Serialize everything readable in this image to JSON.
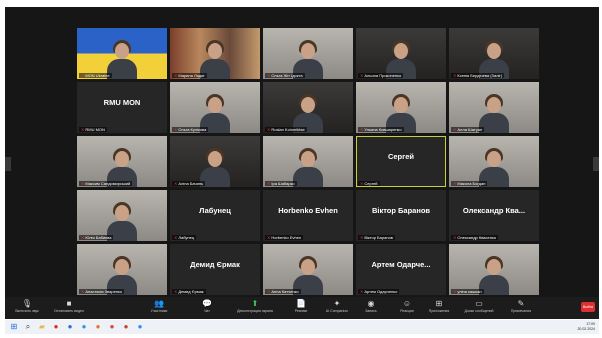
{
  "participants": [
    {
      "name": "",
      "label": "MON Ukraine",
      "bg": "flag"
    },
    {
      "name": "",
      "label": "Марина Лядиг",
      "bg": "books"
    },
    {
      "name": "",
      "label": "Ольга Жіт Ідокта",
      "bg": "room-light"
    },
    {
      "name": "",
      "label": "Альона Прокопенко",
      "bg": "room-dark"
    },
    {
      "name": "",
      "label": "Ксенія Бердічева (Заліг)",
      "bg": "room-dark"
    },
    {
      "name": "RMU MON",
      "label": "RMU MON",
      "bg": "plain"
    },
    {
      "name": "",
      "label": "Ольга Кулікова",
      "bg": "room-light"
    },
    {
      "name": "",
      "label": "Ruslan Kolomibtse",
      "bg": "room-dark"
    },
    {
      "name": "",
      "label": "Ульяна Ковшаренко",
      "bg": "room-light"
    },
    {
      "name": "",
      "label": "Алла Шатуан",
      "bg": "room-light"
    },
    {
      "name": "",
      "label": "Максим Сандомирський",
      "bg": "room-light"
    },
    {
      "name": "",
      "label": "Аліна Бачинь",
      "bg": "room-dark"
    },
    {
      "name": "",
      "label": "Іра Шабарко",
      "bg": "room-light"
    },
    {
      "name": "Сергей",
      "label": "Сергей",
      "bg": "plain",
      "speaking": true
    },
    {
      "name": "",
      "label": "Микола Богдан",
      "bg": "room-light"
    },
    {
      "name": "",
      "label": "Юлія Бабиєва",
      "bg": "room-light"
    },
    {
      "name": "Лабунец",
      "label": "Лабунец",
      "bg": "plain"
    },
    {
      "name": "Horbenko Evhen",
      "label": "Horbenko Evhen",
      "bg": "plain"
    },
    {
      "name": "Віктор Баранов",
      "label": "Віктор Баранов",
      "bg": "plain"
    },
    {
      "name": "Олександр Ква...",
      "label": "Олександр Квасенко",
      "bg": "plain"
    },
    {
      "name": "",
      "label": "Анастасія Зваренко",
      "bg": "room-light"
    },
    {
      "name": "Демид Єрмак",
      "label": "Демид Єрмак",
      "bg": "plain"
    },
    {
      "name": "",
      "label": "Анна Катченко",
      "bg": "room-light"
    },
    {
      "name": "Артем Одарче...",
      "label": "Артем Одарченко",
      "bg": "plain"
    },
    {
      "name": "",
      "label": "уліна кашкан",
      "bg": "room-light"
    }
  ],
  "toolbar": {
    "items": [
      {
        "icon": "mic-icon",
        "glyph": "🎙",
        "label": "Включить звук"
      },
      {
        "icon": "video-icon",
        "glyph": "■",
        "label": "Остановить видео"
      },
      {
        "icon": "participants-icon",
        "glyph": "👥",
        "label": "Участники"
      },
      {
        "icon": "chat-icon",
        "glyph": "💬",
        "label": "Чат"
      },
      {
        "icon": "share-screen-icon",
        "glyph": "⬆",
        "label": "Демонстрация экрана",
        "accent": true
      },
      {
        "icon": "summary-icon",
        "glyph": "📄",
        "label": "Резюме"
      },
      {
        "icon": "ai-companion-icon",
        "glyph": "✦",
        "label": "AI Companion"
      },
      {
        "icon": "record-icon",
        "glyph": "◉",
        "label": "Запись"
      },
      {
        "icon": "reactions-icon",
        "glyph": "☺",
        "label": "Реакции"
      },
      {
        "icon": "apps-icon",
        "glyph": "⊞",
        "label": "Приложения"
      },
      {
        "icon": "whiteboard-icon",
        "glyph": "▭",
        "label": "Доски сообщений"
      },
      {
        "icon": "notes-icon",
        "glyph": "✎",
        "label": "Примечания"
      }
    ],
    "end_label": "Выйти"
  },
  "tray": {
    "time": "17:09",
    "date": "20.02.2024"
  },
  "colors": {
    "speaking_border": "#c9cf3a",
    "mic_muted": "#e0383a",
    "end_button": "#e02f2f"
  }
}
